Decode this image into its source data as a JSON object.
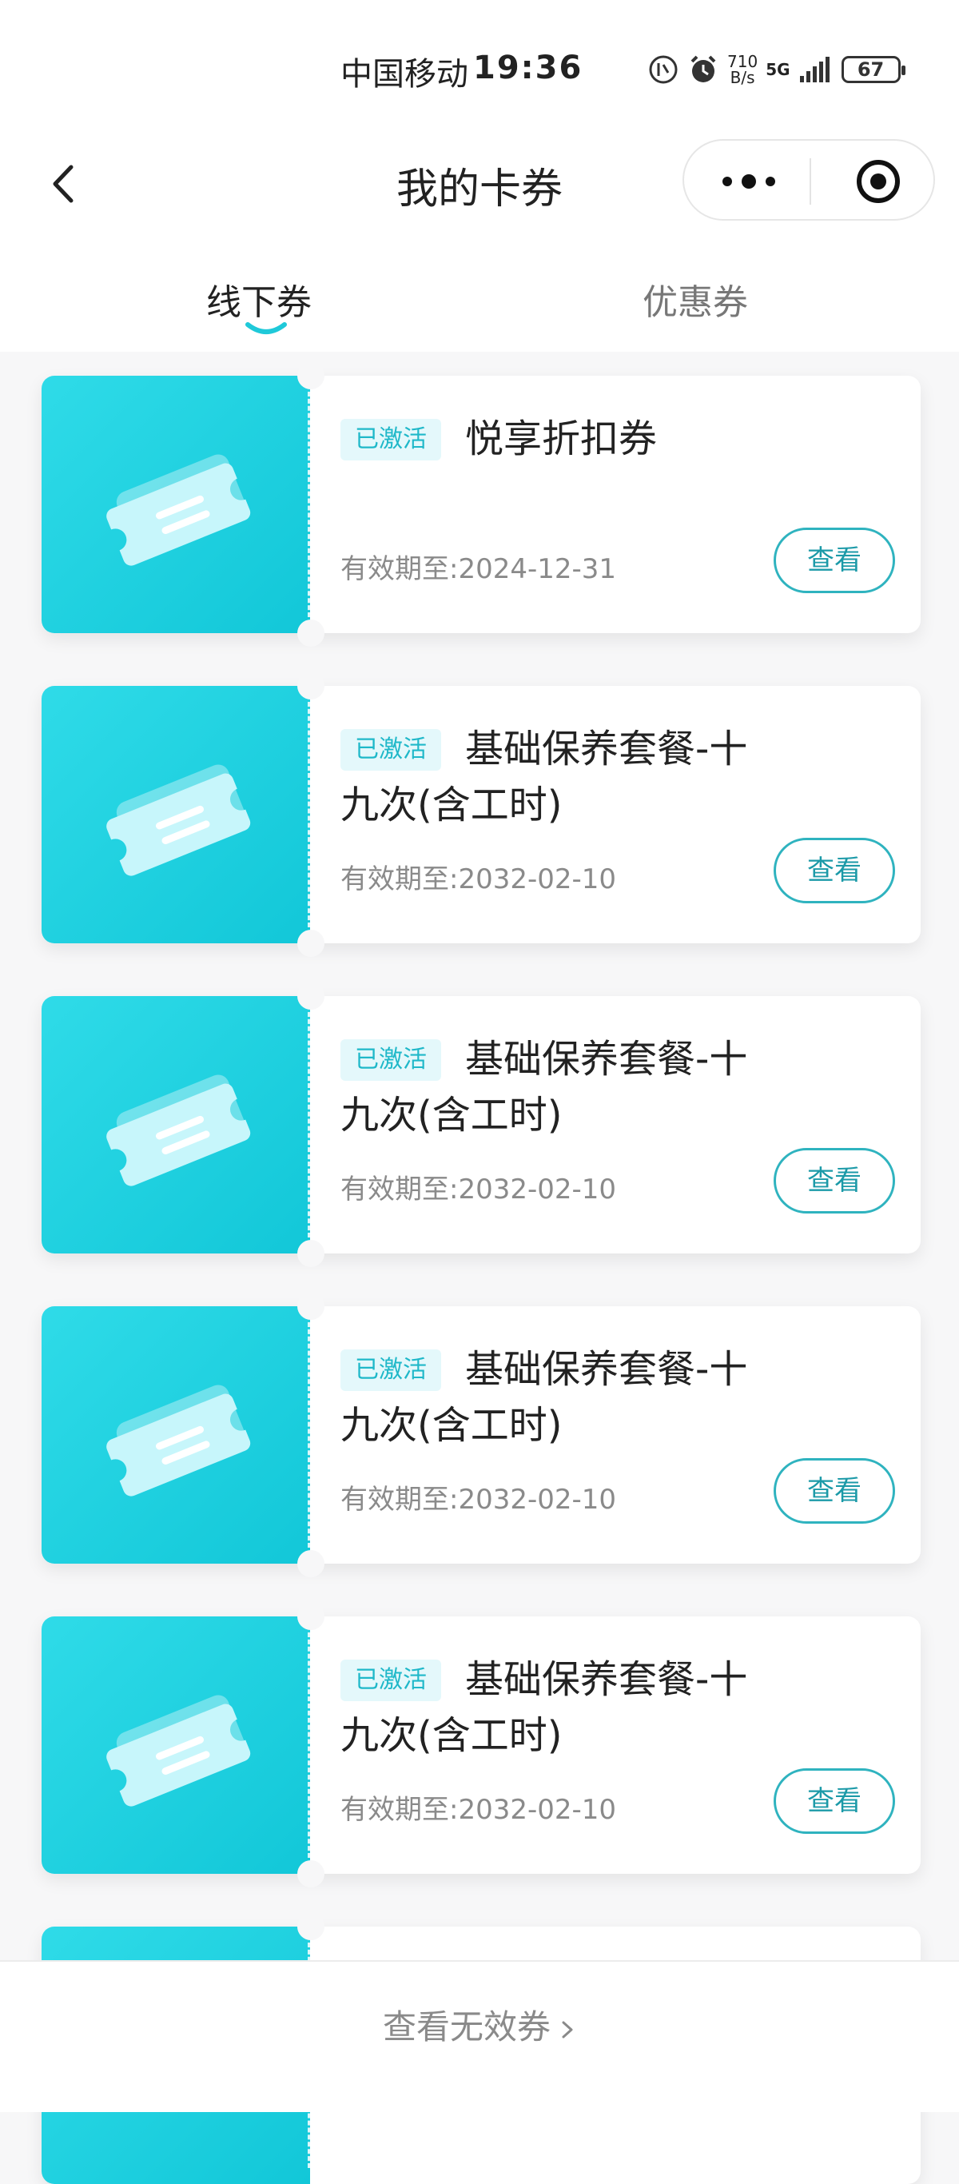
{
  "status_bar": {
    "carrier": "中国移动",
    "time": "19:36",
    "speed_top": "710",
    "speed_bottom": "B/s",
    "network": "5G",
    "battery": "67"
  },
  "nav": {
    "title": "我的卡券"
  },
  "tabs": [
    {
      "label": "线下券",
      "active": true
    },
    {
      "label": "优惠券",
      "active": false
    }
  ],
  "coupons": [
    {
      "badge": "已激活",
      "title": "悦享折扣券",
      "expiry": "有效期至:2024-12-31",
      "button": "查看"
    },
    {
      "badge": "已激活",
      "title": "基础保养套餐-十九次(含工时)",
      "expiry": "有效期至:2032-02-10",
      "button": "查看"
    },
    {
      "badge": "已激活",
      "title": "基础保养套餐-十九次(含工时)",
      "expiry": "有效期至:2032-02-10",
      "button": "查看"
    },
    {
      "badge": "已激活",
      "title": "基础保养套餐-十九次(含工时)",
      "expiry": "有效期至:2032-02-10",
      "button": "查看"
    },
    {
      "badge": "已激活",
      "title": "基础保养套餐-十九次(含工时)",
      "expiry": "有效期至:2032-02-10",
      "button": "查看"
    }
  ],
  "footer": {
    "invalid_link": "查看无效券"
  },
  "colors": {
    "accent": "#1fc9d9",
    "button_border": "#2fb3bf",
    "badge_bg": "#e4f8fb"
  }
}
